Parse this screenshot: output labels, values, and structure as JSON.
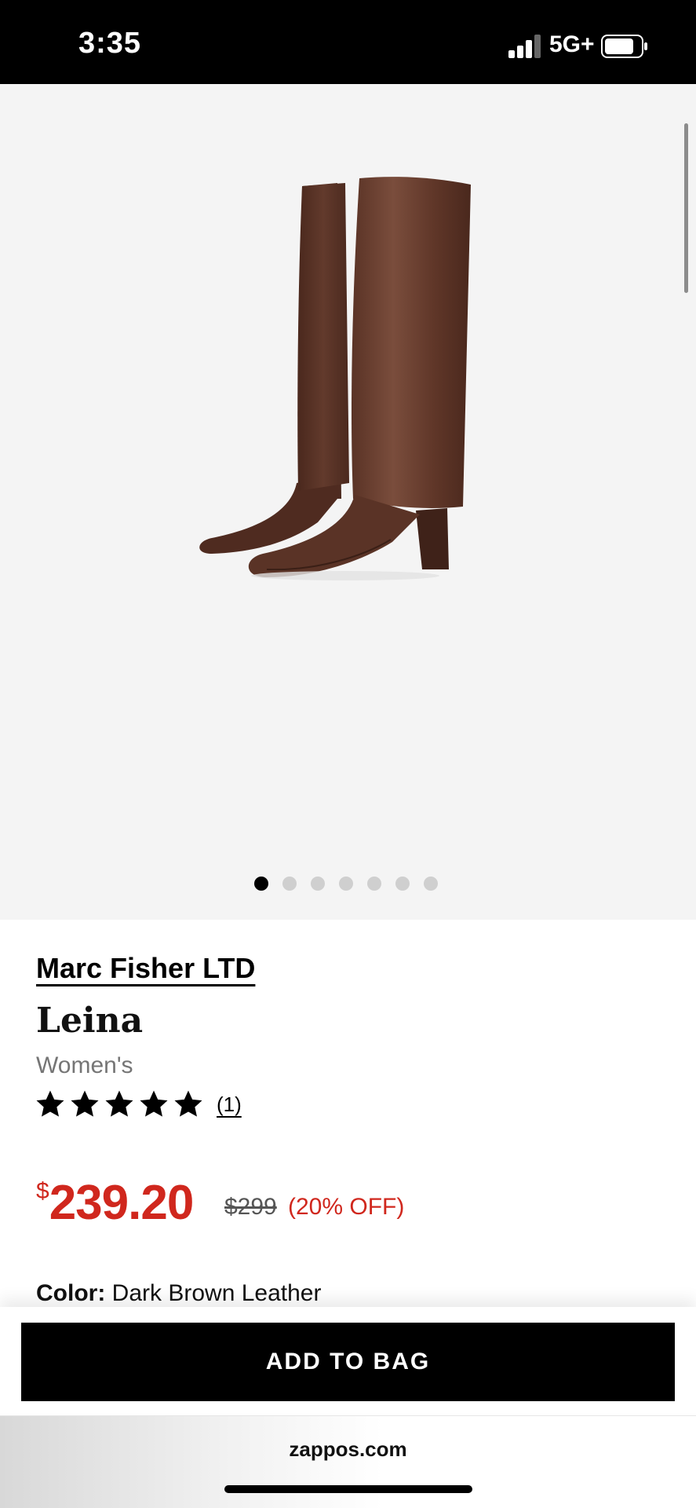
{
  "status_bar": {
    "time": "3:35",
    "network": "5G+",
    "icons": [
      "signal-icon",
      "battery-icon"
    ]
  },
  "product": {
    "brand": "Marc Fisher LTD",
    "name": "Leina",
    "gender": "Women's",
    "rating": {
      "stars": 5,
      "max_stars": 5,
      "review_count": "(1)"
    },
    "price": {
      "currency_symbol": "$",
      "sale_price": "239.20",
      "original_price": "$299",
      "discount": "(20% OFF)"
    },
    "color": {
      "label": "Color:",
      "value": "Dark Brown Leather"
    },
    "image_carousel": {
      "total": 7,
      "active_index": 0
    }
  },
  "actions": {
    "add_to_bag_label": "ADD TO BAG"
  },
  "browser": {
    "url": "zappos.com"
  },
  "colors": {
    "sale_red": "#d0271d",
    "boot_brown": "#5a3326",
    "image_bg": "#f4f4f4"
  }
}
